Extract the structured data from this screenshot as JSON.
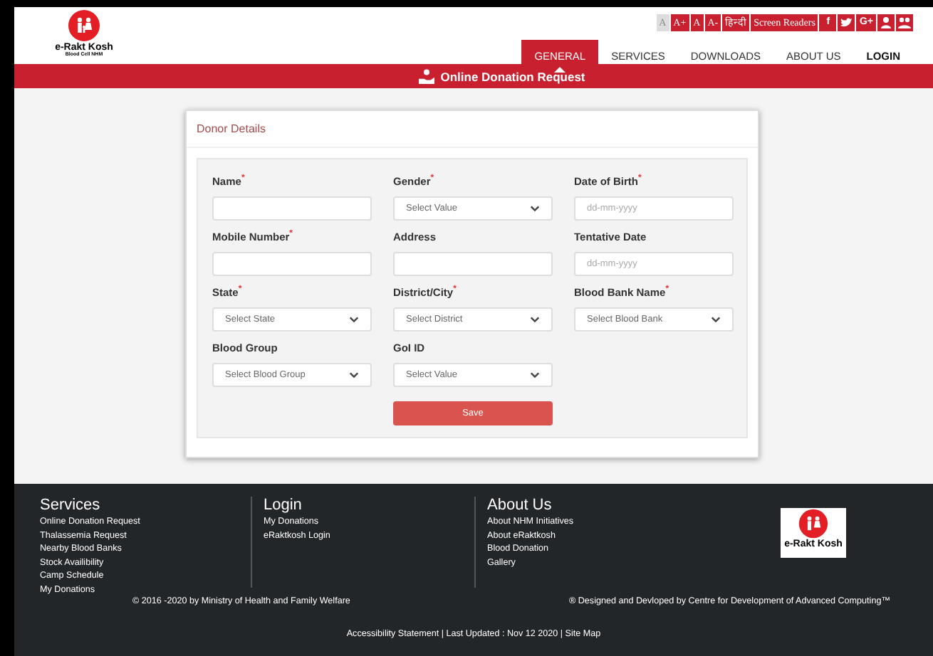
{
  "header": {
    "logo": {
      "title": "e-Rakt Kosh",
      "subtitle": "Blood Cell NHM"
    },
    "tools": [
      {
        "label": "A",
        "selected": true
      },
      {
        "label": "A+",
        "selected": false
      },
      {
        "label": "A",
        "selected": false
      },
      {
        "label": "A-",
        "selected": false
      },
      {
        "label": "हिन्दी",
        "selected": false
      },
      {
        "label": "Screen Readers",
        "selected": false
      }
    ],
    "social": [
      {
        "kind": "text",
        "label": "f"
      },
      {
        "kind": "twitter"
      },
      {
        "kind": "text",
        "label": "G+"
      },
      {
        "kind": "person"
      },
      {
        "kind": "group"
      }
    ],
    "nav": [
      {
        "label": "GENERAL",
        "selected": true
      },
      {
        "label": "SERVICES",
        "selected": false
      },
      {
        "label": "DOWNLOADS",
        "selected": false
      },
      {
        "label": "ABOUT US",
        "selected": false
      },
      {
        "label": "LOGIN",
        "selected": false
      }
    ]
  },
  "banner": {
    "title": "Online Donation Request"
  },
  "form": {
    "title": "Donor Details",
    "fields": [
      {
        "label": "Name$^{*}$",
        "kind": "input"
      },
      {
        "label": "Gender$^{*}$",
        "kind": "select",
        "placeholder": "Select Value"
      },
      {
        "label": "Date of Birth$^{*}$",
        "kind": "date",
        "placeholder": "dd-mm-yyyy"
      },
      {
        "label": "Mobile Number$^{*}$",
        "kind": "input"
      },
      {
        "label": "Address",
        "kind": "input"
      },
      {
        "label": "Tentative Date",
        "kind": "date",
        "placeholder": "dd-mm-yyyy"
      },
      {
        "label": "State$^{*}$",
        "kind": "select",
        "placeholder": "Select State"
      },
      {
        "label": "District/City$^{*}$",
        "kind": "select",
        "placeholder": "Select District"
      },
      {
        "label": "Blood Bank Name$^{*}$",
        "kind": "select",
        "placeholder": "Select Blood Bank"
      },
      {
        "label": "Blood Group",
        "kind": "select",
        "placeholder": "Select Blood Group"
      },
      {
        "label": "GoI ID",
        "kind": "select",
        "placeholder": "Select Value"
      }
    ],
    "submit": "Save"
  },
  "footer": {
    "columns": [
      {
        "title": "Services",
        "links": [
          "Online Donation Request",
          "Thalassemia Request",
          "Nearby Blood Banks",
          "Stock Availibility",
          "Camp Schedule",
          "My Donations"
        ]
      },
      {
        "title": "Login",
        "links": [
          "My Donations",
          "eRaktkosh Login"
        ]
      },
      {
        "title": "About Us",
        "links": [
          "About NHM Initiatives",
          "About eRaktkosh",
          "Blood Donation",
          "Gallery"
        ]
      }
    ],
    "logo": {
      "title": "e-Rakt Kosh"
    },
    "copyright": "© 2016 -2020 by Ministry of Health and Family Welfare",
    "credit": "® Designed and Devloped by Centre for Development of Advanced Computing™",
    "bottom": "Accessibility Statement | Last Updated : Nov 12 2020 | Site Map"
  }
}
